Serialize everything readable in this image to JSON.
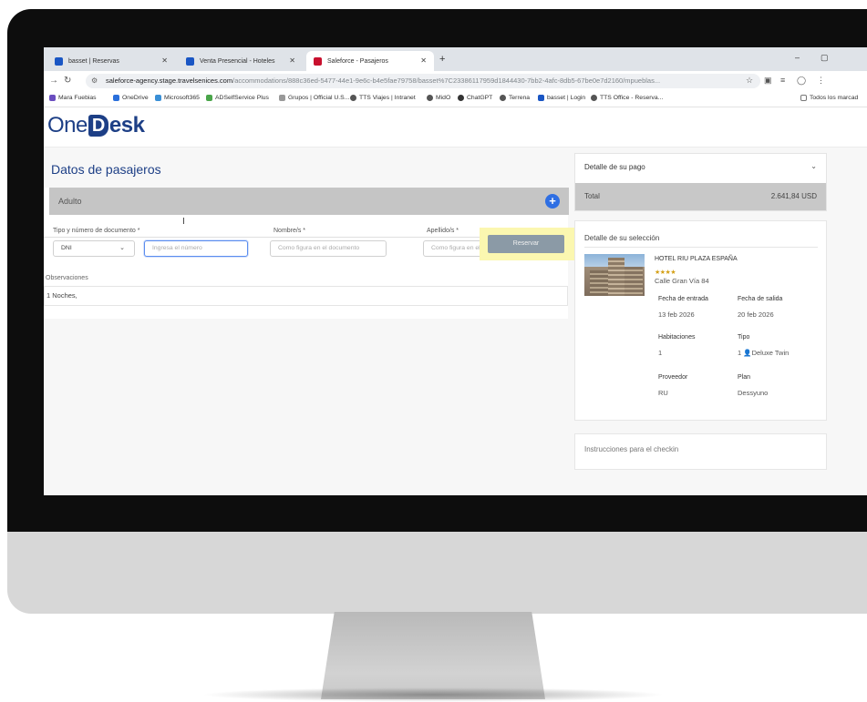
{
  "browser": {
    "tabs": [
      {
        "title": "basset | Reservas",
        "color": "#1a56c4"
      },
      {
        "title": "Venta Presencial - Hoteles",
        "color": "#1a56c4"
      },
      {
        "title": "Saleforce - Pasajeros",
        "color": "#c8102e"
      }
    ],
    "url_host": "saleforce-agency.stage.travelsenices.com",
    "url_path": "/accommodations/888c36ed-5477-44e1-9e6c-b4e5fae79758/basset%7C23386117959d1844430-7bb2-4afc-8db5-67be0e7d2160/mpueblas...",
    "bookmarks": [
      "Mara Fuebias",
      "OneDrive",
      "Microsoft365",
      "ADSelfService Plus",
      "Grupos | Official U.S...",
      "TTS Viajes | Intranet",
      "MidO",
      "ChatGPT",
      "Terrena",
      "basset | Login",
      "TTS Office - Reserva...",
      "Todos los marcad"
    ]
  },
  "app": {
    "logo": {
      "one": "One",
      "d": "D",
      "esk": "esk"
    },
    "page_title": "Datos de pasajeros",
    "passenger": {
      "section_label": "Adulto",
      "add_label": "+",
      "doc_label": "Tipo y número de documento *",
      "doc_type": "DNI",
      "doc_number_placeholder": "Ingresa el número",
      "name_label": "Nombre/s *",
      "name_placeholder": "Como figura en el documento",
      "surname_label": "Apellido/s *",
      "surname_placeholder": "Como figura en el documento"
    },
    "reserve_button": "Reservar",
    "observations_label": "Observaciones",
    "observations_value": "1 Noches,",
    "payment": {
      "header": "Detalle de su pago",
      "total_label": "Total",
      "total_value": "2.641,84 USD"
    },
    "selection": {
      "header": "Detalle de su selección",
      "hotel_name": "HOTEL RIU PLAZA ESPAÑA",
      "stars": "★★★★",
      "address": "Calle Gran Vía 84",
      "checkin_label": "Fecha de entrada",
      "checkin_value": "13 feb 2026",
      "checkout_label": "Fecha de salida",
      "checkout_value": "20 feb 2026",
      "rooms_label": "Habitaciones",
      "rooms_value": "1",
      "type_label": "Tipo",
      "type_value": "1 👤Deluxe Twin",
      "provider_label": "Proveedor",
      "provider_value": "RU",
      "plan_label": "Plan",
      "plan_value": "Dessyuno"
    },
    "instructions_header": "Instrucciones para el checkin"
  }
}
